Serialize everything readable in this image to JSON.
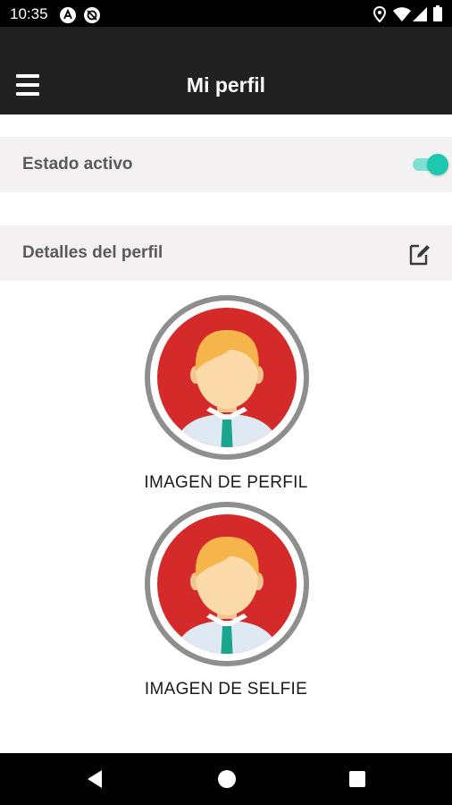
{
  "status_bar": {
    "time": "10:35",
    "icons": [
      "notification-a-icon",
      "notification-sync-off-icon",
      "location-icon",
      "wifi-icon",
      "signal-icon",
      "battery-icon"
    ]
  },
  "app_bar": {
    "title": "Mi perfil",
    "menu_icon": "hamburger-menu-icon"
  },
  "status_row": {
    "label": "Estado activo",
    "toggle_on": true
  },
  "details_row": {
    "label": "Detalles del perfil",
    "action_icon": "edit-icon"
  },
  "profile_image": {
    "caption": "IMAGEN DE PERFIL",
    "icon": "user-avatar-icon"
  },
  "selfie_image": {
    "caption": "IMAGEN DE SELFIE",
    "icon": "user-avatar-icon"
  },
  "nav_bar": {
    "buttons": [
      "back-icon",
      "home-icon",
      "recents-icon"
    ]
  },
  "colors": {
    "app_bar": "#212121",
    "section_bg": "#f3f1f1",
    "toggle_accent": "#1ec8b0",
    "avatar_bg": "#d42a2a",
    "avatar_ring": "#8e8e8e"
  }
}
